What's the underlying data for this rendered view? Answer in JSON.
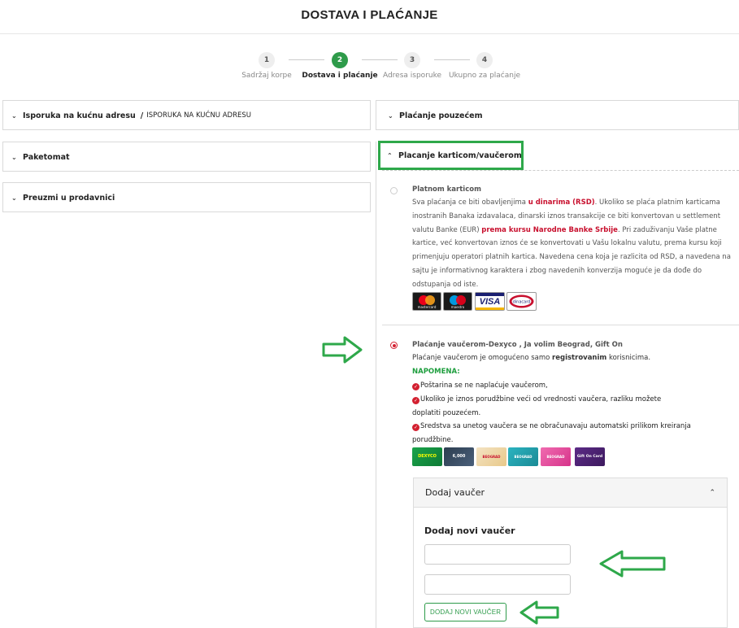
{
  "page": {
    "title": "DOSTAVA I PLAĆANJE"
  },
  "steps": [
    {
      "num": "1",
      "label": "Sadržaj korpe"
    },
    {
      "num": "2",
      "label": "Dostava i plaćanje"
    },
    {
      "num": "3",
      "label": "Adresa isporuke"
    },
    {
      "num": "4",
      "label": "Ukupno za plaćanje"
    }
  ],
  "delivery": {
    "home": {
      "label": "Isporuka na kućnu adresu",
      "sep": "/",
      "sub": "ISPORUKA NA KUĆNU ADRESU"
    },
    "paketomat": {
      "label": "Paketomat"
    },
    "store": {
      "label": "Preuzmi u prodavnici"
    }
  },
  "payment": {
    "cod": {
      "label": "Plaćanje pouzećem"
    },
    "card_voucher": {
      "label": "Placanje karticom/vaučerom"
    },
    "card": {
      "title": "Platnom karticom",
      "text_1": "Sva plaćanja ce biti obavljenjima ",
      "text_red_1": "u dinarima (RSD)",
      "text_2": ". Ukoliko se plaća platnim karticama inostranih Banaka izdavalaca, dinarski iznos transakcije ce biti konvertovan u settlement valutu Banke (EUR) ",
      "text_red_2": "prema kursu Narodne Banke Srbije",
      "text_3": ". Pri zaduživanju Vaše platne kartice, već konvertovan iznos će se konvertovati u Vašu lokalnu valutu, prema kursu koji primenjuju operatori platnih kartica. Navedena cena koja je razlicita od RSD, a navedena na sajtu je informativnog karaktera i zbog navedenih konverzija moguće je da dođe do odstupanja od iste.",
      "logos": [
        "mastercard",
        "maestro",
        "VISA",
        "dinacard"
      ]
    },
    "voucher": {
      "title": "Plaćanje vaučerom-Dexyco , Ja volim Beograd, Gift On",
      "line_1a": "Plaćanje vaučerom je omogućeno samo ",
      "line_1b": "registrovanim",
      "line_1c": " korisnicima.",
      "note": "NAPOMENA:",
      "bullets": [
        "Poštarina se ne naplaćuje vaučerom,",
        "Ukoliko je iznos porudžbine veći od vrednosti vaučera, razliku možete doplatiti pouzećem.",
        "Sredstva sa unetog vaučera se ne obračunavaju automatski prilikom kreiranja porudžbine."
      ],
      "images": [
        "DEXYCO",
        "6,000",
        "BEOGRAD",
        "BEOGRAD",
        "BEOGRAD",
        "Gift On Card"
      ]
    }
  },
  "voucher_box": {
    "header": "Dodaj vaučer",
    "subtitle": "Dodaj novi vaučer",
    "input_1": "",
    "input_2": "",
    "button": "DODAJ NOVI VAUČER"
  },
  "colors": {
    "accent_green": "#2e9b4a",
    "highlight_green": "#2ea84a",
    "red": "#c8102e"
  },
  "icons": [
    "chevron-down-icon",
    "chevron-up-icon",
    "check-circle-icon",
    "arrow-right-icon",
    "arrow-left-icon"
  ]
}
